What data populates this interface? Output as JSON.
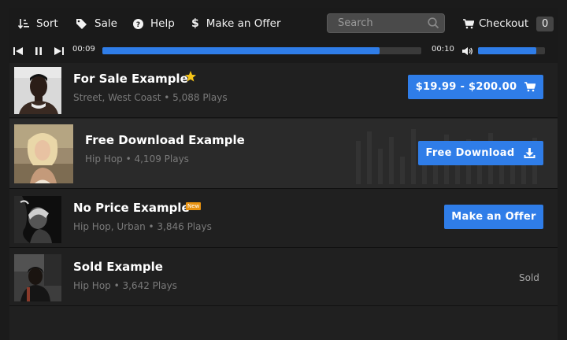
{
  "nav": {
    "sort_label": "Sort",
    "sale_label": "Sale",
    "help_label": "Help",
    "offer_label": "Make an Offer",
    "search_placeholder": "Search",
    "checkout_label": "Checkout",
    "cart_count": "0"
  },
  "player": {
    "elapsed": "00:09",
    "remaining": "00:10",
    "progress_percent": 87,
    "volume_percent": 87
  },
  "colors": {
    "accent": "#2f7de8",
    "star": "#f5c518",
    "new_badge": "#e8920f"
  },
  "tracks": [
    {
      "title": "For Sale Example",
      "meta": "Street, West Coast • 5,088 Plays",
      "badge_icon": "star-icon",
      "button_label": "$19.99 - $200.00",
      "button_icon": "cart-icon"
    },
    {
      "title": "Free Download Example",
      "meta": "Hip Hop • 4,109 Plays",
      "button_label": "Free Download",
      "button_icon": "download-icon"
    },
    {
      "title": "No Price Example",
      "meta": "Hip Hop, Urban • 3,846 Plays",
      "badge_text": "New",
      "button_label": "Make an Offer"
    },
    {
      "title": "Sold Example",
      "meta": "Hip Hop • 3,642 Plays",
      "status_label": "Sold"
    }
  ]
}
